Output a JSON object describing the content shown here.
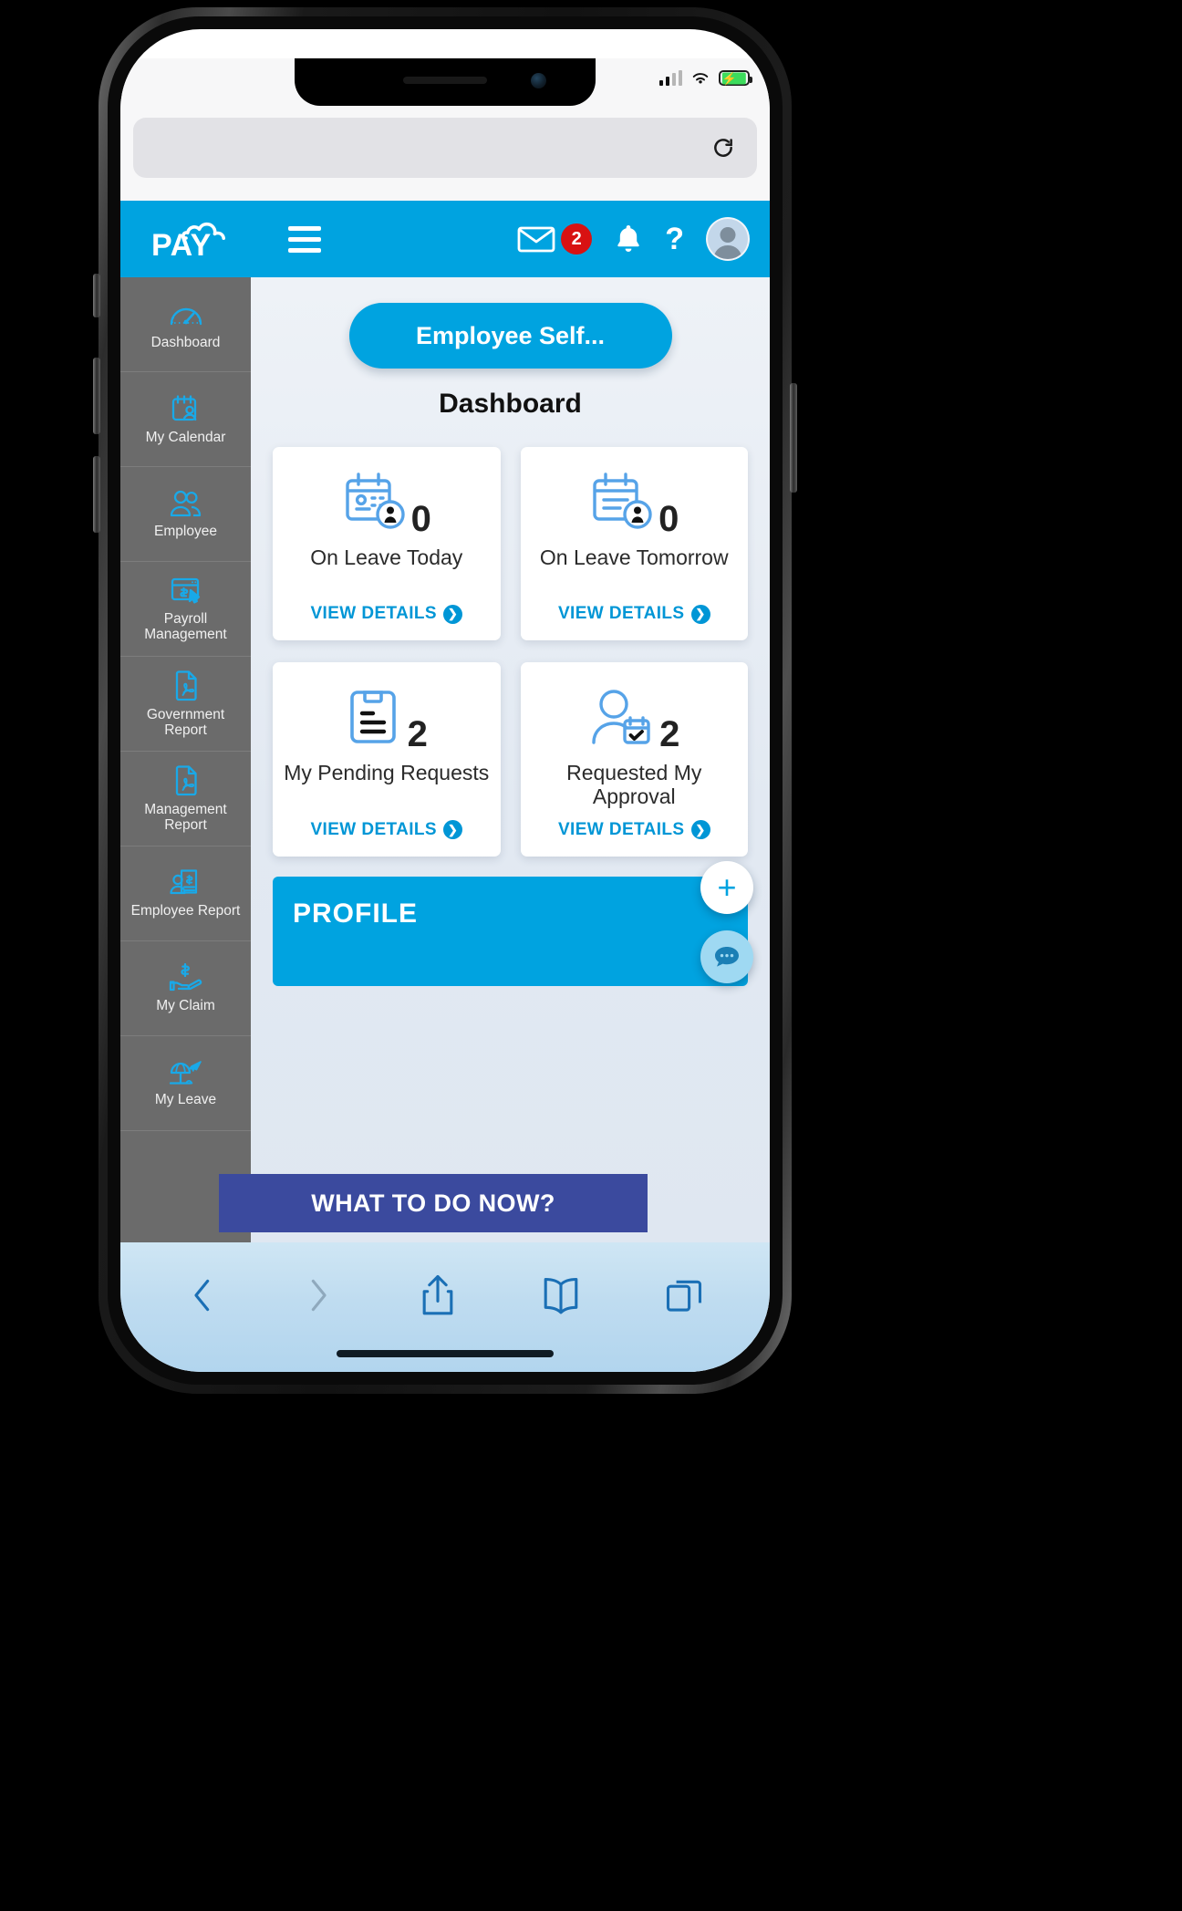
{
  "status_bar": {
    "signal_icon": "cellular-signal-icon",
    "wifi_icon": "wifi-icon",
    "battery_icon": "battery-charging-icon"
  },
  "browser": {
    "url_value": "",
    "url_placeholder": "",
    "reload_icon": "reload-icon",
    "toolbar": {
      "back_icon": "chevron-left-icon",
      "forward_icon": "chevron-right-icon",
      "share_icon": "share-icon",
      "bookmarks_icon": "book-icon",
      "tabs_icon": "tabs-icon"
    }
  },
  "app_header": {
    "logo_text": "PAY",
    "logo_icon": "cloud-icon",
    "menu_icon": "hamburger-menu-icon",
    "mail_icon": "mail-icon",
    "mail_badge": "2",
    "bell_icon": "bell-icon",
    "help_label": "?",
    "avatar_icon": "user-avatar-icon",
    "brand_color": "#00a3e0"
  },
  "sidebar": {
    "items": [
      {
        "label": "Dashboard",
        "icon": "gauge-icon"
      },
      {
        "label": "My Calendar",
        "icon": "calendar-user-icon"
      },
      {
        "label": "Employee",
        "icon": "people-icon"
      },
      {
        "label": "Payroll Management",
        "icon": "payroll-cursor-icon"
      },
      {
        "label": "Government Report",
        "icon": "pdf-file-icon"
      },
      {
        "label": "Management Report",
        "icon": "pdf-file-icon"
      },
      {
        "label": "Employee Report",
        "icon": "employee-payslip-icon"
      },
      {
        "label": "My Claim",
        "icon": "hand-dollar-icon"
      },
      {
        "label": "My Leave",
        "icon": "beach-umbrella-plane-icon"
      }
    ]
  },
  "main": {
    "ess_button_label": "Employee Self...",
    "page_title": "Dashboard",
    "view_details_label": "VIEW DETAILS",
    "chevron_icon": "chevron-right-circle-icon",
    "cards": [
      {
        "count": "0",
        "label": "On Leave Today",
        "icon": "calendar-person-icon"
      },
      {
        "count": "0",
        "label": "On Leave Tomorrow",
        "icon": "calendar-person-icon"
      },
      {
        "count": "2",
        "label": "My Pending Requests",
        "icon": "clipboard-lines-icon"
      },
      {
        "count": "2",
        "label": "Requested My Approval",
        "icon": "person-calendar-check-icon"
      }
    ],
    "profile_section_title": "PROFILE",
    "fab_add_icon": "plus-icon",
    "fab_chat_icon": "chat-bubble-icon"
  },
  "banner": {
    "text": "WHAT TO DO NOW?",
    "color": "#3b4a9e"
  }
}
